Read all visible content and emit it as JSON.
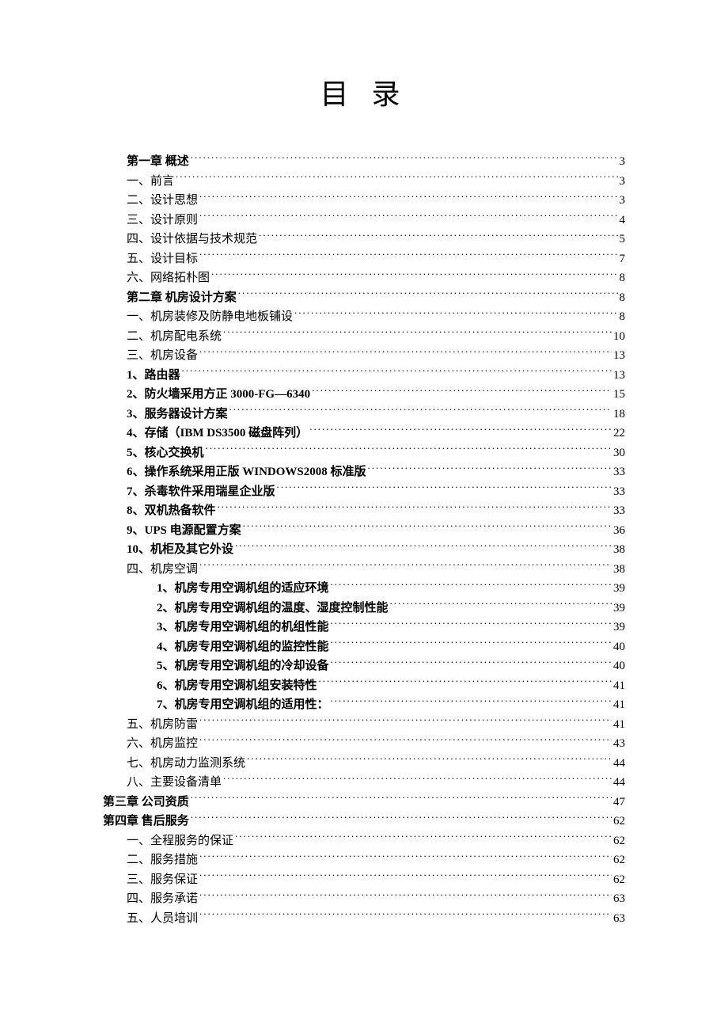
{
  "title": "目 录",
  "toc": [
    {
      "label": "第一章 概述",
      "page": "3",
      "indent": 1,
      "bold": true
    },
    {
      "label": "一、前言",
      "page": "3",
      "indent": 1,
      "bold": false
    },
    {
      "label": "二、设计思想",
      "page": "3",
      "indent": 1,
      "bold": false
    },
    {
      "label": "三、设计原则",
      "page": "4",
      "indent": 1,
      "bold": false
    },
    {
      "label": "四、设计依据与技术规范",
      "page": "5",
      "indent": 1,
      "bold": false
    },
    {
      "label": "五、设计目标",
      "page": "7",
      "indent": 1,
      "bold": false
    },
    {
      "label": "六、网络拓朴图",
      "page": "8",
      "indent": 1,
      "bold": false
    },
    {
      "label": "第二章 机房设计方案",
      "page": "8",
      "indent": 1,
      "bold": true
    },
    {
      "label": "一、机房装修及防静电地板铺设",
      "page": "8",
      "indent": 1,
      "bold": false
    },
    {
      "label": "二、机房配电系统",
      "page": "10",
      "indent": 1,
      "bold": false
    },
    {
      "label": "三、机房设备",
      "page": "13",
      "indent": 1,
      "bold": false
    },
    {
      "label": "1、路由器",
      "page": "13",
      "indent": 1,
      "bold": true
    },
    {
      "label": "2、防火墙采用方正 3000-FG—6340",
      "page": "15",
      "indent": 1,
      "bold": true
    },
    {
      "label": "3、服务器设计方案",
      "page": "18",
      "indent": 1,
      "bold": true
    },
    {
      "label": "4、存储（IBM DS3500 磁盘阵列）",
      "page": "22",
      "indent": 1,
      "bold": true
    },
    {
      "label": "5、核心交换机",
      "page": "30",
      "indent": 1,
      "bold": true
    },
    {
      "label": "6、操作系统采用正版 WINDOWS2008 标准版",
      "page": "33",
      "indent": 1,
      "bold": true
    },
    {
      "label": "7、杀毒软件采用瑞星企业版",
      "page": "33",
      "indent": 1,
      "bold": true
    },
    {
      "label": "8、双机热备软件",
      "page": "33",
      "indent": 1,
      "bold": true
    },
    {
      "label": "9、UPS 电源配置方案",
      "page": "36",
      "indent": 1,
      "bold": true
    },
    {
      "label": "10、机柜及其它外设",
      "page": "38",
      "indent": 1,
      "bold": true
    },
    {
      "label": "四、机房空调",
      "page": "38",
      "indent": 1,
      "bold": false
    },
    {
      "label": "1、机房专用空调机组的适应环境",
      "page": "39",
      "indent": 2,
      "bold": true
    },
    {
      "label": "2、机房专用空调机组的温度、湿度控制性能",
      "page": "39",
      "indent": 2,
      "bold": true
    },
    {
      "label": "3、机房专用空调机组的机组性能",
      "page": "39",
      "indent": 2,
      "bold": true
    },
    {
      "label": "4、机房专用空调机组的监控性能",
      "page": "40",
      "indent": 2,
      "bold": true
    },
    {
      "label": "5、机房专用空调机组的冷却设备",
      "page": "40",
      "indent": 2,
      "bold": true
    },
    {
      "label": "6、机房专用空调机组安装特性",
      "page": "41",
      "indent": 2,
      "bold": true
    },
    {
      "label": "7、机房专用空调机组的适用性：",
      "page": "41",
      "indent": 2,
      "bold": true
    },
    {
      "label": "五、机房防雷",
      "page": "41",
      "indent": 1,
      "bold": false
    },
    {
      "label": "六、机房监控",
      "page": "43",
      "indent": 1,
      "bold": false
    },
    {
      "label": "七、机房动力监测系统",
      "page": "44",
      "indent": 1,
      "bold": false
    },
    {
      "label": "八、主要设备清单",
      "page": "44",
      "indent": 1,
      "bold": false
    },
    {
      "label": "第三章 公司资质",
      "page": "47",
      "indent": 0,
      "bold": true
    },
    {
      "label": "第四章 售后服务",
      "page": "62",
      "indent": 0,
      "bold": true
    },
    {
      "label": "一、全程服务的保证",
      "page": "62",
      "indent": 1,
      "bold": false
    },
    {
      "label": "二、服务措施",
      "page": "62",
      "indent": 1,
      "bold": false
    },
    {
      "label": "三、服务保证",
      "page": "62",
      "indent": 1,
      "bold": false
    },
    {
      "label": "四、服务承诺",
      "page": "63",
      "indent": 1,
      "bold": false
    },
    {
      "label": "五、人员培训",
      "page": "63",
      "indent": 1,
      "bold": false
    }
  ]
}
